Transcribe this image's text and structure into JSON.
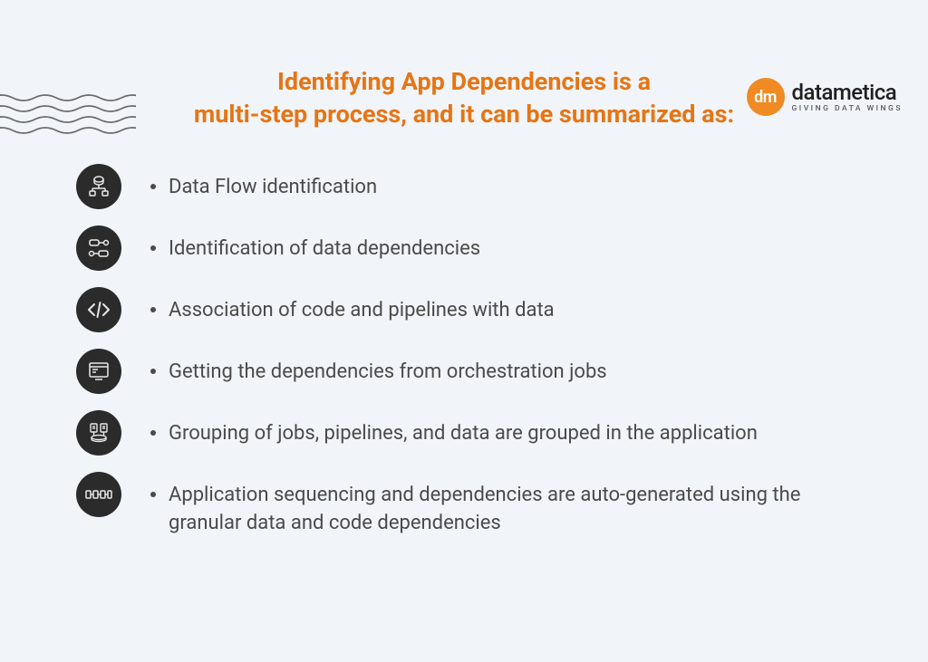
{
  "brand": {
    "mark": "dm",
    "name": "datametica",
    "tagline": "GIVING DATA WINGS"
  },
  "heading_line1": "Identifying App Dependencies is a",
  "heading_line2": "multi-step process, and it can be summarized as:",
  "steps": [
    {
      "icon": "flow-icon",
      "text": "Data Flow identification"
    },
    {
      "icon": "dependency-icon",
      "text": "Identification of data dependencies"
    },
    {
      "icon": "code-icon",
      "text": "Association of code and pipelines with data"
    },
    {
      "icon": "terminal-icon",
      "text": "Getting the dependencies from orchestration jobs"
    },
    {
      "icon": "group-icon",
      "text": "Grouping of jobs, pipelines, and data are grouped in the application"
    },
    {
      "icon": "sequence-icon",
      "text": "Application sequencing and dependencies are auto-generated using the granular data and code dependencies"
    }
  ],
  "colors": {
    "accent": "#e67515",
    "bg": "#f1f5f9",
    "icon_bg": "#2b2b2b",
    "text": "#4a4a4a"
  }
}
